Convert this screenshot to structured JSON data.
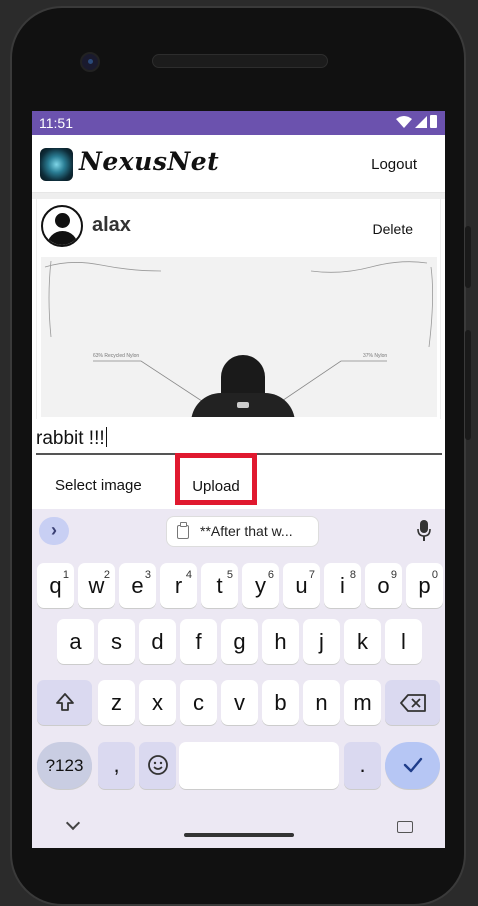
{
  "status_bar": {
    "time": "11:51"
  },
  "app_bar": {
    "title": "NexusNet",
    "logout_label": "Logout"
  },
  "post": {
    "username": "alax",
    "delete_label": "Delete",
    "image_labels": {
      "left": "63% Recycled Nylon",
      "right": "37% Nylon"
    }
  },
  "composer": {
    "text_value": "rabbit !!!",
    "select_image_label": "Select image",
    "upload_label": "Upload"
  },
  "keyboard": {
    "clipboard_suggestion": "**After that w...",
    "row1": [
      {
        "key": "q",
        "hint": "1"
      },
      {
        "key": "w",
        "hint": "2"
      },
      {
        "key": "e",
        "hint": "3"
      },
      {
        "key": "r",
        "hint": "4"
      },
      {
        "key": "t",
        "hint": "5"
      },
      {
        "key": "y",
        "hint": "6"
      },
      {
        "key": "u",
        "hint": "7"
      },
      {
        "key": "i",
        "hint": "8"
      },
      {
        "key": "o",
        "hint": "9"
      },
      {
        "key": "p",
        "hint": "0"
      }
    ],
    "row2": [
      "a",
      "s",
      "d",
      "f",
      "g",
      "h",
      "j",
      "k",
      "l"
    ],
    "row3": [
      "z",
      "x",
      "c",
      "v",
      "b",
      "n",
      "m"
    ],
    "row4": {
      "symbols": "?123",
      "comma": ",",
      "period": "."
    },
    "icons": [
      "expand-icon",
      "clipboard-icon",
      "mic-icon",
      "shift-icon",
      "backspace-icon",
      "emoji-icon",
      "enter-check-icon",
      "hide-keyboard-icon",
      "keyboard-switch-icon"
    ]
  },
  "colors": {
    "status_bar": "#6b52ae",
    "upload_highlight": "#e0192f",
    "keyboard_bg": "#ece8f3"
  }
}
